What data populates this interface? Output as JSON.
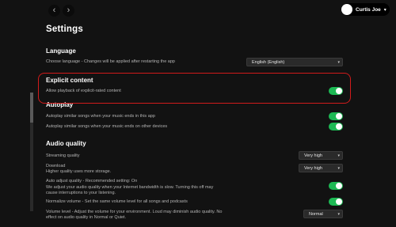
{
  "header": {
    "back_icon": "chevron-left-icon",
    "forward_icon": "chevron-right-icon",
    "user_name": "Curtis Joe"
  },
  "page_title": "Settings",
  "language": {
    "heading": "Language",
    "label": "Choose language - Changes will be applied after restarting the app",
    "selected": "English (English)"
  },
  "explicit": {
    "heading": "Explicit content",
    "label": "Allow playback of explicit-rated content",
    "enabled": true
  },
  "autoplay": {
    "heading": "Autoplay",
    "app_label": "Autoplay similar songs when your music ends in this app",
    "app_enabled": true,
    "devices_label": "Autoplay similar songs when your music ends on other devices",
    "devices_enabled": true
  },
  "audio": {
    "heading": "Audio quality",
    "streaming_label": "Streaming quality",
    "streaming_value": "Very high",
    "download_label": "Download",
    "download_sub": "Higher quality uses more storage.",
    "download_value": "Very high",
    "auto_adjust_title": "Auto adjust quality - Recommended setting: On",
    "auto_adjust_desc_1": "We adjust your audio quality when your Internet bandwidth is slow. Turning this off may",
    "auto_adjust_desc_2": "cause interruptions to your listening.",
    "auto_adjust_enabled": true,
    "normalize_label": "Normalize volume - Set the same volume level for all songs and podcasts",
    "normalize_enabled": true,
    "volume_level_1": "Volume level - Adjust the volume for your environment. Loud may diminish audio quality. No",
    "volume_level_2": "effect on audio quality in Normal or Quiet.",
    "volume_level_value": "Normal"
  },
  "colors": {
    "accent": "#1db954",
    "highlight": "#d11b1b",
    "background": "#121212"
  }
}
